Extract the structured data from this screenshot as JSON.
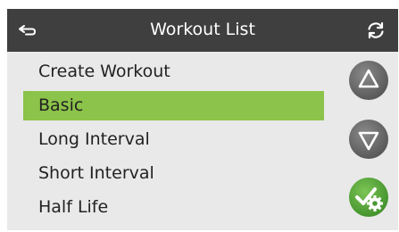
{
  "header": {
    "title": "Workout List",
    "back_icon": "back-arrow-icon",
    "refresh_icon": "refresh-icon"
  },
  "workouts": [
    {
      "label": "Create Workout",
      "selected": false
    },
    {
      "label": "Basic",
      "selected": true
    },
    {
      "label": "Long Interval",
      "selected": false
    },
    {
      "label": "Short Interval",
      "selected": false
    },
    {
      "label": "Half Life",
      "selected": false
    }
  ],
  "side_buttons": {
    "up_icon": "triangle-up-icon",
    "down_icon": "triangle-down-icon",
    "confirm_icon": "checkmark-gear-icon"
  },
  "colors": {
    "header_bg": "#3f3f3f",
    "screen_bg": "#e9e9e9",
    "selected_bg": "#8cc34a",
    "nav_button": "#6b6b6b",
    "confirm_button": "#5fae3b"
  }
}
